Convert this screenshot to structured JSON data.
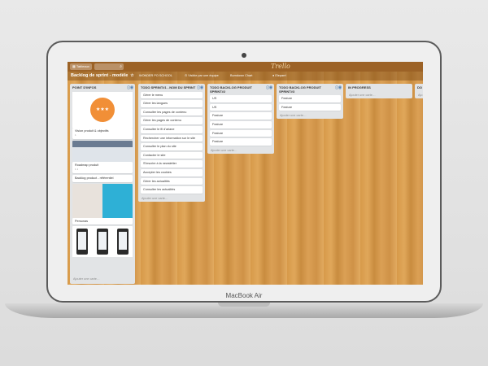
{
  "device": {
    "label": "MacBook Air"
  },
  "app": {
    "boards_button": "Tableaux",
    "logo": "Trello",
    "board_title": "Backlog de sprint - modèle",
    "org": "WONDER PO SCHOOL",
    "visibility": "Visible par une équipe",
    "powerup": "Burndown Chart",
    "member": "Eleparrt"
  },
  "lists": [
    {
      "title": "POINT D'INFOS",
      "cards": [
        {
          "label": "Vision produit & objectifs",
          "badge": "1"
        },
        {
          "label": "Roadmap produit",
          "badge": "1  1"
        },
        {
          "label": "Backlog product - référentiel"
        },
        {
          "label": "Personas"
        }
      ],
      "add": "Ajouter une carte…"
    },
    {
      "title": "TODO SPRINT#1 - NOM DU SPRINT",
      "cards": [
        {
          "label": "Gérer le menu"
        },
        {
          "label": "Gérer les langues"
        },
        {
          "label": "Consulter les pages de contenu"
        },
        {
          "label": "Gérer les pages de contenu"
        },
        {
          "label": "Consulter le fil d'ariane"
        },
        {
          "label": "Rechercher une information sur le site"
        },
        {
          "label": "Consulter le plan du site"
        },
        {
          "label": "Contacter le site"
        },
        {
          "label": "S'inscrire à la newsletter"
        },
        {
          "label": "Accepter les cookies"
        },
        {
          "label": "Gérer les actualités"
        },
        {
          "label": "Consulter les actualités"
        }
      ],
      "add": "Ajouter une carte…"
    },
    {
      "title": "TODO BACKLOG PRODUIT SPRINT#2",
      "cards": [
        {
          "label": "US"
        },
        {
          "label": "US"
        },
        {
          "label": "Feature"
        },
        {
          "label": "Feature"
        },
        {
          "label": "Feature"
        },
        {
          "label": "Feature"
        }
      ],
      "add": "Ajouter une carte…"
    },
    {
      "title": "TODO BACKLOG PRODUIT SPRINT#3",
      "cards": [
        {
          "label": "Feature"
        },
        {
          "label": "Feature"
        }
      ],
      "add": "Ajouter une carte…"
    },
    {
      "title": "IN PROGRESS",
      "cards": [],
      "add": "Ajouter une carte…"
    },
    {
      "title": "DO",
      "cards": [],
      "add": "Ajo"
    }
  ],
  "colors": {
    "wood": "#d79a4a",
    "header": "#9c6226",
    "list_bg": "#e2e4e6",
    "vision_orange": "#f18f37"
  }
}
